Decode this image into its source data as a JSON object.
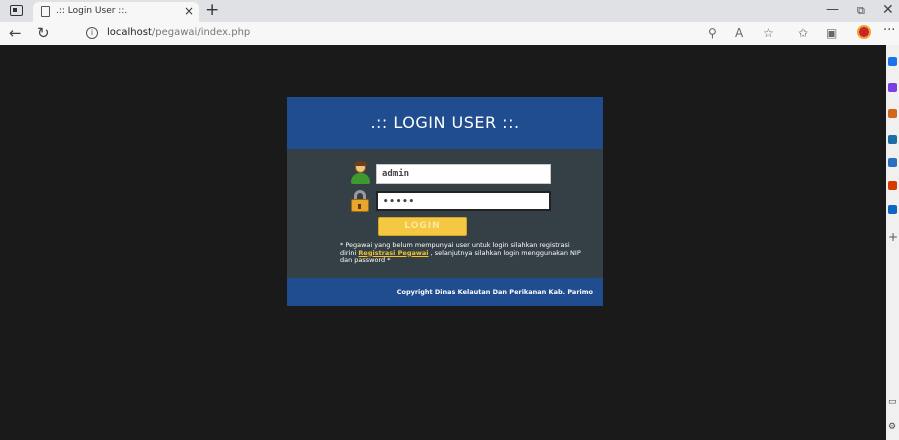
{
  "browser": {
    "tab_title": ".:: Login User ::.",
    "tab_close": "×",
    "new_tab": "+",
    "url_host": "localhost",
    "url_path": "/pegawai/index.php",
    "info_glyph": "i",
    "window_controls": {
      "minimize": "—",
      "restore": "⧉",
      "close": "✕"
    },
    "toolbar_icons": [
      "puzzle-icon",
      "read-aloud-icon",
      "favorite-icon",
      "favorites-icon",
      "collections-icon",
      "profile-icon",
      "more-icon"
    ],
    "more_glyph": "···"
  },
  "sidebar": {
    "icons": [
      {
        "name": "search-icon",
        "color": "#1a73e8"
      },
      {
        "name": "sparkle-icon",
        "color": "#7b3fe4"
      },
      {
        "name": "shopping-icon",
        "color": "#d06a1a"
      },
      {
        "name": "tools-icon",
        "color": "#1d6ea8"
      },
      {
        "name": "people-icon",
        "color": "#2a6fc1"
      },
      {
        "name": "office-icon",
        "color": "#d83b01"
      },
      {
        "name": "outlook-icon",
        "color": "#0a67c3"
      }
    ],
    "plus_glyph": "+"
  },
  "login": {
    "title": ".:: LOGIN USER ::.",
    "username_value": "admin",
    "password_value": "•••••",
    "button_label": "LOGIN",
    "info_prefix": "* Pegawai yang belum mempunyai user untuk login silahkan registrasi dirini",
    "info_link": "Registrasi Pegawai",
    "info_suffix": ", selanjutnya silahkan login menggunakan NIP dan password *",
    "copyright": "Copyright Dinas Kelautan Dan Perikanan Kab. Parimo"
  },
  "colors": {
    "header_blue": "#1f4d8f",
    "panel_dark": "#354046",
    "button_yellow": "#f4c842",
    "link_yellow": "#f2c12e",
    "page_bg": "#1a1a1a"
  }
}
